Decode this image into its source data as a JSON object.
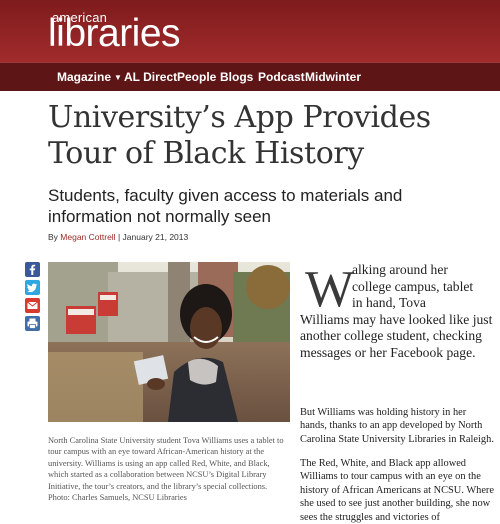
{
  "brand": {
    "prefix": "american",
    "name": "libraries"
  },
  "nav": {
    "items": [
      {
        "label": "Magazine",
        "has_dropdown": true
      },
      {
        "label": "AL Direct"
      },
      {
        "label": "People"
      },
      {
        "label": "Blogs"
      },
      {
        "label": "Podcast"
      },
      {
        "label": "Midwinter"
      }
    ]
  },
  "article": {
    "title": "University’s App Provides Tour of Black History",
    "subtitle": "Students, faculty given access to materials and information not normally seen",
    "byline_prefix": "By",
    "author": "Megan Cottrell",
    "separator": "|",
    "date": "January 21, 2013",
    "dropcap": "W",
    "intro_line1": "alking around her",
    "intro_line2": "college campus, tablet",
    "intro_line3": "in hand, Tova",
    "intro_rest": "Williams may have looked like just another college student, checking messages or her Facebook page.",
    "paragraph2": "But Williams was holding history in her hands, thanks to an app developed by North Carolina State University Libraries in Raleigh.",
    "paragraph3": "The Red, White, and Black app allowed Williams to tour campus with an eye on the history of African Americans at NCSU. Where she used to see just another building, she now sees the struggles and victories of",
    "caption": "North Carolina State University student Tova Williams uses a tablet to tour campus with an eye toward African-American history at the university. Williams is using an app called Red, White, and Black, which started as a collaboration between NCSU’s Digital Library Initiative, the tour’s creators, and the library’s special collections. Photo: Charles Samuels, NCSU Libraries"
  },
  "share": {
    "icons": [
      "facebook-icon",
      "twitter-icon",
      "email-icon",
      "print-icon"
    ]
  },
  "colors": {
    "masthead": "#a12b2c",
    "navbar": "#5e1516",
    "author_link": "#9c2a2a"
  }
}
